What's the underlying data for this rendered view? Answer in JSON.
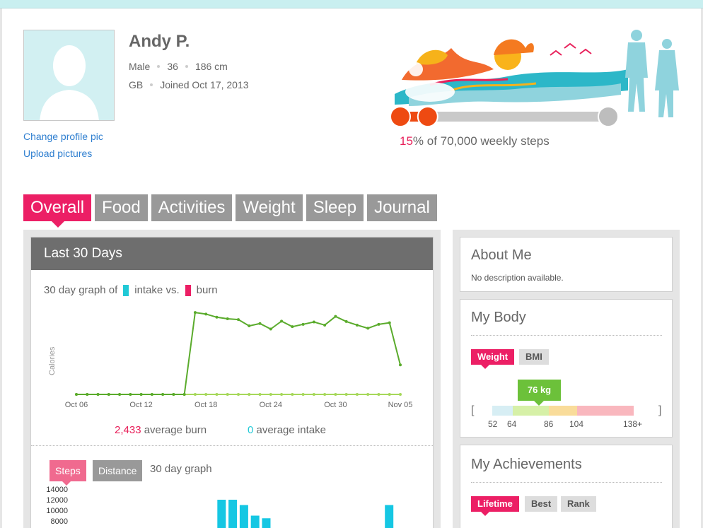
{
  "profile": {
    "name": "Andy P.",
    "gender": "Male",
    "age": "36",
    "height": "186 cm",
    "country": "GB",
    "joined": "Joined Oct 17, 2013",
    "change_pic": "Change profile pic",
    "upload_pics": "Upload pictures"
  },
  "steps": {
    "percent": "15",
    "suffix": "% of 70,000 weekly steps",
    "progress_fraction": 0.15
  },
  "tabs": [
    {
      "label": "Overall",
      "active": true
    },
    {
      "label": "Food",
      "active": false
    },
    {
      "label": "Activities",
      "active": false
    },
    {
      "label": "Weight",
      "active": false
    },
    {
      "label": "Sleep",
      "active": false
    },
    {
      "label": "Journal",
      "active": false
    }
  ],
  "last30": {
    "title": "Last 30 Days",
    "graph_prefix": "30 day graph of",
    "intake_label": "intake vs.",
    "burn_label": "burn",
    "avg_burn_value": "2,433",
    "avg_burn_label": "average burn",
    "avg_intake_value": "0",
    "avg_intake_label": "average intake",
    "steps_btn": "Steps",
    "distance_btn": "Distance",
    "graph2_label": "30 day graph"
  },
  "chart_data": [
    {
      "type": "line",
      "ylabel": "Calories",
      "x_ticks": [
        "Oct 06",
        "Oct 12",
        "Oct 18",
        "Oct 24",
        "Oct 30",
        "Nov 05"
      ],
      "series": [
        {
          "values": [
            0,
            0,
            0,
            0,
            0,
            0,
            0,
            0,
            0,
            0,
            0,
            2080,
            2040,
            1960,
            1920,
            1900,
            1740,
            1800,
            1660,
            1860,
            1720,
            1780,
            1840,
            1760,
            1980,
            1850,
            1760,
            1680,
            1780,
            1820,
            750
          ]
        },
        {
          "values": [
            0,
            0,
            0,
            0,
            0,
            0,
            0,
            0,
            0,
            0,
            0,
            0,
            0,
            0,
            0,
            0,
            0,
            0,
            0,
            0,
            0,
            0,
            0,
            0,
            0,
            0,
            0,
            0,
            0,
            0,
            0
          ]
        }
      ],
      "colors": {
        "burn": "#5aab2c",
        "intake": "#a6d85a"
      }
    },
    {
      "type": "bar",
      "y_ticks": [
        "14000",
        "12000",
        "10000",
        "8000"
      ],
      "values": [
        0,
        0,
        0,
        0,
        0,
        0,
        0,
        0,
        0,
        0,
        0,
        0,
        0,
        12000,
        12000,
        11000,
        9000,
        8500,
        0,
        0,
        0,
        0,
        0,
        0,
        0,
        0,
        0,
        0,
        11000,
        0
      ],
      "color": "#15c7e3"
    }
  ],
  "about": {
    "title": "About Me",
    "text": "No description available."
  },
  "body": {
    "title": "My Body",
    "weight_btn": "Weight",
    "bmi_btn": "BMI",
    "weight_value": "76 kg",
    "scale_labels": [
      "52",
      "64",
      "86",
      "104",
      "138+"
    ],
    "scale_colors": [
      "#d7eef4",
      "#d6f0a7",
      "#f9dc9a",
      "#f9b7be"
    ]
  },
  "achievements": {
    "title": "My Achievements",
    "lifetime_btn": "Lifetime",
    "best_btn": "Best",
    "rank_btn": "Rank"
  },
  "colors": {
    "accent": "#ec1f65",
    "link": "#2f7fd0",
    "header_strip": "#c9eff0"
  }
}
